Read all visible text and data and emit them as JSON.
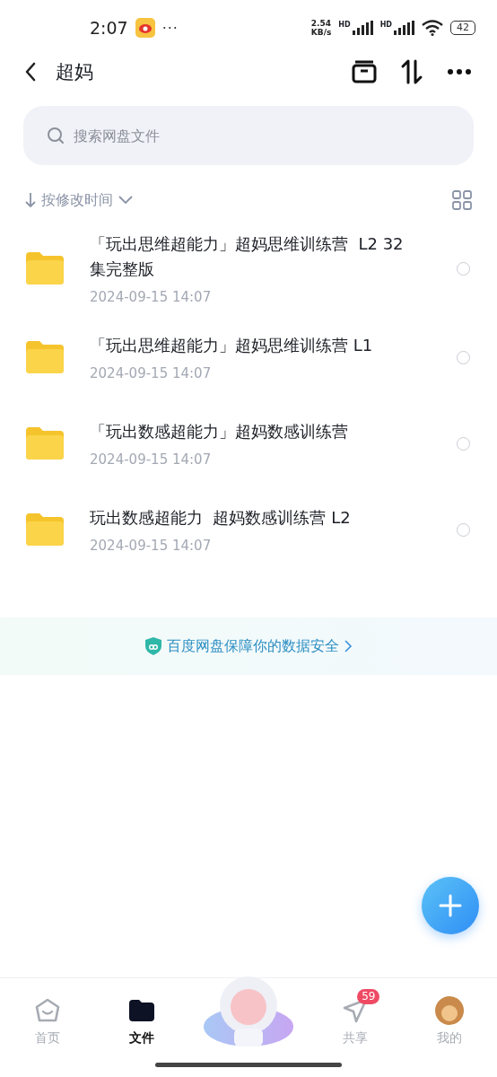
{
  "status_bar": {
    "time": "2:07",
    "more": "···",
    "speed": "2.54",
    "speed_unit": "KB/s",
    "sim_labels": [
      "HD",
      "HD"
    ],
    "battery": "42"
  },
  "header": {
    "title": "超妈"
  },
  "search": {
    "placeholder": "搜索网盘文件"
  },
  "sort": {
    "label": "按修改时间"
  },
  "files": [
    {
      "name": "「玩出思维超能力」超妈思维训练营  L2 32集完整版",
      "date": "2024-09-15  14:07",
      "selected": false
    },
    {
      "name": "「玩出思维超能力」超妈思维训练营 L1",
      "date": "2024-09-15  14:07",
      "selected": false
    },
    {
      "name": "「玩出数感超能力」超妈数感训练营",
      "date": "2024-09-15  14:07",
      "selected": false
    },
    {
      "name": "玩出数感超能力  超妈数感训练营 L2",
      "date": "2024-09-15  14:07",
      "selected": false
    }
  ],
  "banner": {
    "text": "百度网盘保障你的数据安全"
  },
  "nav": [
    {
      "label": "首页",
      "kind": "home",
      "selected": false
    },
    {
      "label": "文件",
      "kind": "files",
      "selected": true
    },
    {
      "kind": "mascot"
    },
    {
      "label": "共享",
      "kind": "share",
      "selected": false,
      "badge": "59"
    },
    {
      "label": "我的",
      "kind": "profile",
      "selected": false
    }
  ]
}
